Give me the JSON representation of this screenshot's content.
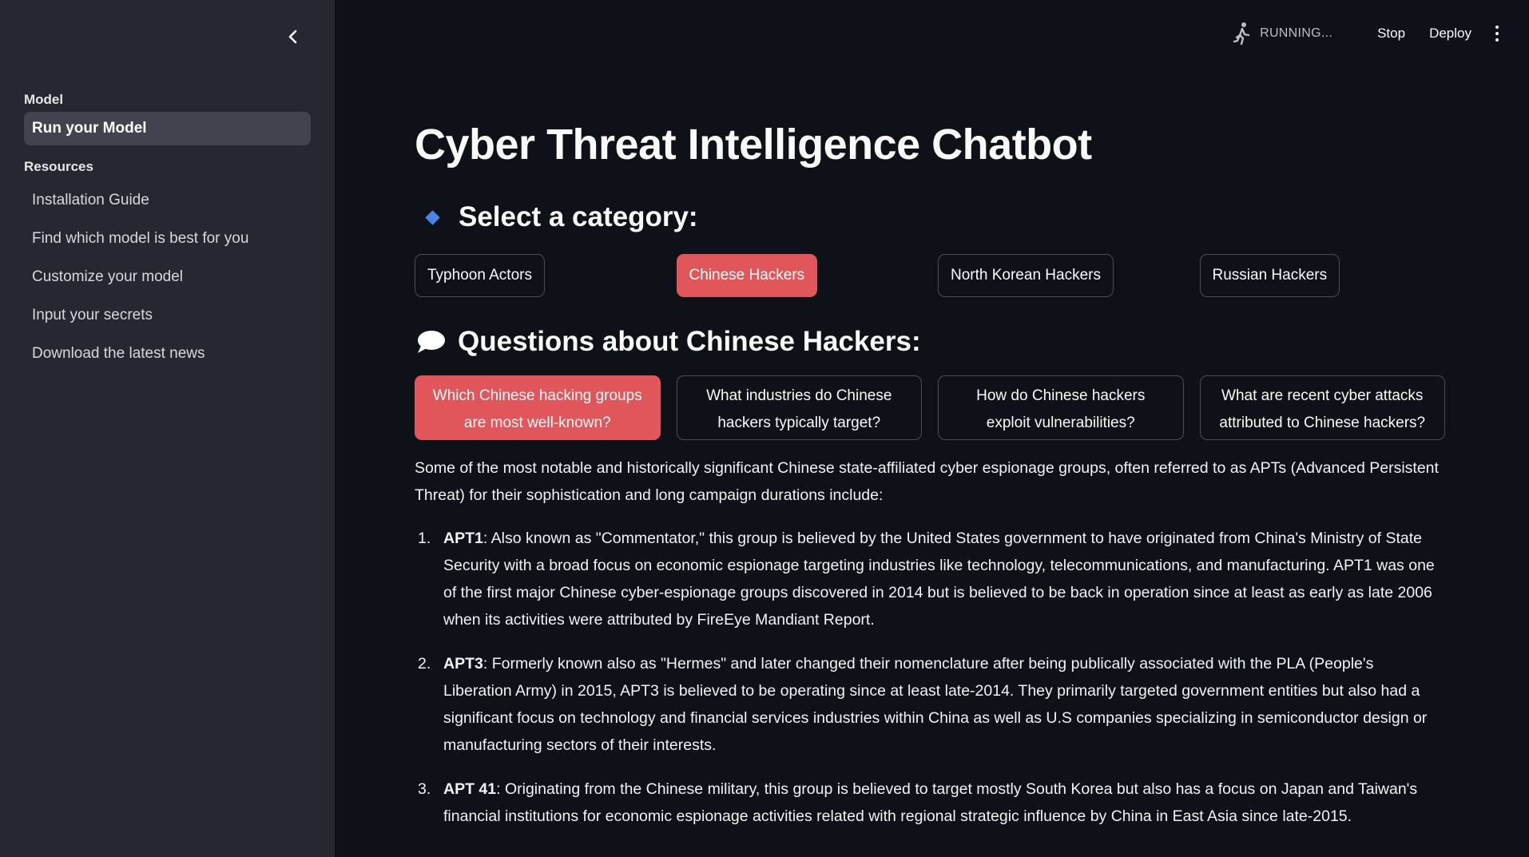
{
  "sidebar": {
    "section_model": "Model",
    "items_model": [
      {
        "label": "Run your Model",
        "active": true
      }
    ],
    "section_resources": "Resources",
    "items_resources": [
      {
        "label": "Installation Guide"
      },
      {
        "label": "Find which model is best for you"
      },
      {
        "label": "Customize your model"
      },
      {
        "label": "Input your secrets"
      },
      {
        "label": "Download the latest news"
      }
    ]
  },
  "topbar": {
    "status": "RUNNING...",
    "stop_label": "Stop",
    "deploy_label": "Deploy"
  },
  "main": {
    "title": "Cyber Threat Intelligence Chatbot",
    "category_heading": "Select a category:",
    "categories": [
      {
        "label": "Typhoon Actors",
        "selected": false
      },
      {
        "label": "Chinese Hackers",
        "selected": true
      },
      {
        "label": "North Korean Hackers",
        "selected": false
      },
      {
        "label": "Russian Hackers",
        "selected": false
      }
    ],
    "questions_heading": "Questions about Chinese Hackers:",
    "questions": [
      {
        "label": "Which Chinese hacking groups are most well-known?",
        "selected": true
      },
      {
        "label": "What industries do Chinese hackers typically target?",
        "selected": false
      },
      {
        "label": "How do Chinese hackers exploit vulnerabilities?",
        "selected": false
      },
      {
        "label": "What are recent cyber attacks attributed to Chinese hackers?",
        "selected": false
      }
    ],
    "answer_intro": "Some of the most notable and historically significant Chinese state-affiliated cyber espionage groups, often referred to as APTs (Advanced Persistent Threat) for their sophistication and long campaign durations include:",
    "answer_items": [
      {
        "num": "1.",
        "name": "APT1",
        "text": ": Also known as \"Commentator,\" this group is believed by the United States government to have originated from China's Ministry of State Security with a broad focus on economic espionage targeting industries like technology, telecommunications, and manufacturing. APT1 was one of the first major Chinese cyber-espionage groups discovered in 2014 but is believed to be back in operation since at least as early as late 2006 when its activities were attributed by FireEye Mandiant Report."
      },
      {
        "num": "2.",
        "name": "APT3",
        "text": ": Formerly known also as \"Hermes\" and later changed their nomenclature after being publically associated with the PLA (People's Liberation Army) in 2015, APT3 is believed to be operating since at least late-2014. They primarily targeted government entities but also had a significant focus on technology and financial services industries within China as well as U.S companies specializing in semiconductor design or manufacturing sectors of their interests."
      },
      {
        "num": "3.",
        "name": "APT 41",
        "text": ": Originating from the Chinese military, this group is believed to target mostly South Korea but also has a focus on Japan and Taiwan's financial institutions for economic espionage activities related with regional strategic influence by China in East Asia since late-2015."
      }
    ]
  },
  "colors": {
    "accent": "#e0565a",
    "sidebar_bg": "#262730",
    "main_bg": "#0e1117",
    "diamond": "#4a86e8"
  },
  "icons": {
    "collapse": "chevron-left-icon",
    "running": "running-man-icon",
    "menu": "kebab-menu-icon",
    "category": "blue-diamond-icon",
    "questions": "speech-bubble-icon"
  }
}
